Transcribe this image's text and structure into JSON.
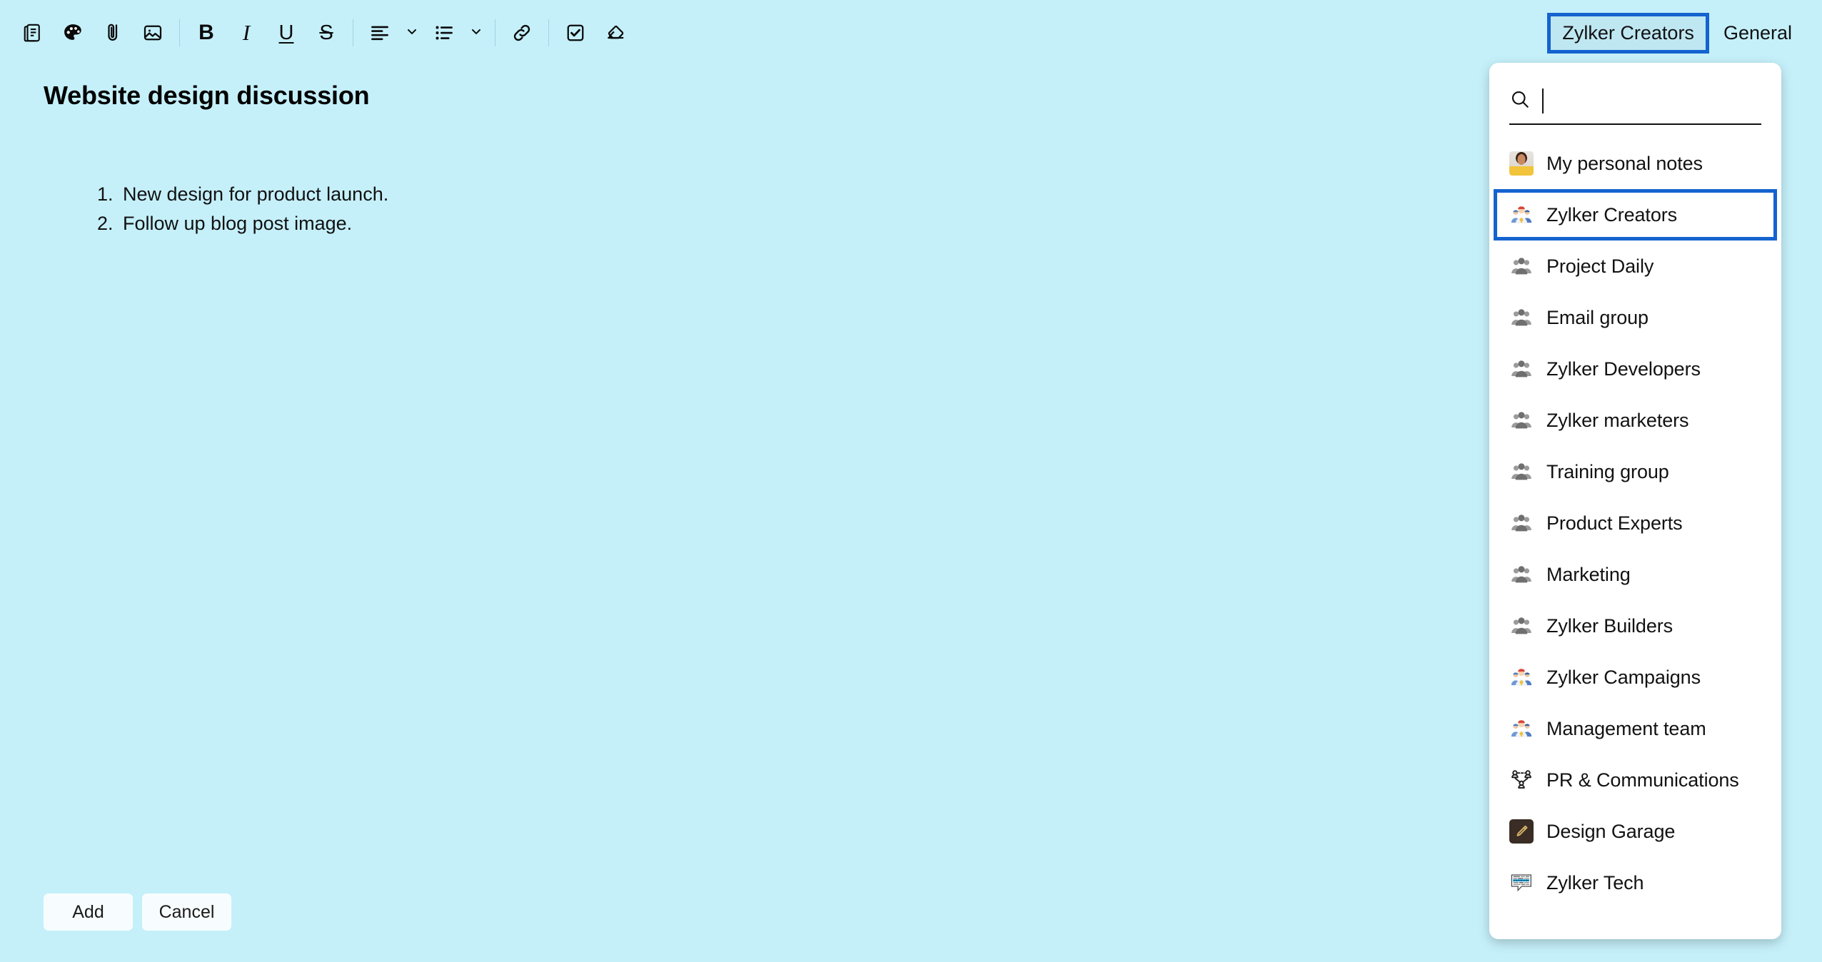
{
  "app": {
    "background_color": "#c5f0fa",
    "accent_focus_color": "#1463cf"
  },
  "toolbar": {
    "items": [
      {
        "icon": "note-icon",
        "label": "Note"
      },
      {
        "icon": "palette-icon",
        "label": "Color"
      },
      {
        "icon": "paperclip-icon",
        "label": "Attach"
      },
      {
        "icon": "image-icon",
        "label": "Image"
      },
      {
        "icon": "bold-icon",
        "label": "B"
      },
      {
        "icon": "italic-icon",
        "label": "I"
      },
      {
        "icon": "underline-icon",
        "label": "U"
      },
      {
        "icon": "strikethrough-icon",
        "label": "S"
      },
      {
        "icon": "align-left-icon",
        "label": "Align"
      },
      {
        "icon": "bullet-list-icon",
        "label": "List"
      },
      {
        "icon": "link-icon",
        "label": "Link"
      },
      {
        "icon": "checkbox-icon",
        "label": "Checklist"
      },
      {
        "icon": "eraser-icon",
        "label": "Clear formatting"
      }
    ]
  },
  "top_tabs": {
    "selected": "Zylker Creators",
    "items": [
      {
        "label": "Zylker Creators",
        "focused": true
      },
      {
        "label": "General",
        "focused": false
      }
    ]
  },
  "document": {
    "title": "Website design discussion",
    "list_items": [
      "New design for product launch.",
      "Follow up blog post image."
    ]
  },
  "footer": {
    "add_label": "Add",
    "cancel_label": "Cancel"
  },
  "dropdown": {
    "search": {
      "value": "",
      "placeholder": "",
      "icon": "search-icon"
    },
    "items": [
      {
        "label": "My personal notes",
        "icon": "avatar-photo",
        "focused": false
      },
      {
        "label": "Zylker Creators",
        "icon": "group-color-icon",
        "focused": true
      },
      {
        "label": "Project Daily",
        "icon": "group-gray-icon",
        "focused": false
      },
      {
        "label": "Email group",
        "icon": "group-gray-icon",
        "focused": false
      },
      {
        "label": "Zylker Developers",
        "icon": "group-gray-icon",
        "focused": false
      },
      {
        "label": "Zylker marketers",
        "icon": "group-gray-icon",
        "focused": false
      },
      {
        "label": "Training group",
        "icon": "group-gray-icon",
        "focused": false
      },
      {
        "label": "Product Experts",
        "icon": "group-gray-icon",
        "focused": false
      },
      {
        "label": "Marketing",
        "icon": "group-gray-icon",
        "focused": false
      },
      {
        "label": "Zylker Builders",
        "icon": "group-gray-icon",
        "focused": false
      },
      {
        "label": "Zylker Campaigns",
        "icon": "group-color-icon",
        "focused": false
      },
      {
        "label": "Management team",
        "icon": "group-color-icon",
        "focused": false
      },
      {
        "label": "PR & Communications",
        "icon": "network-people-icon",
        "focused": false
      },
      {
        "label": "Design Garage",
        "icon": "pencil-tile-icon",
        "focused": false
      },
      {
        "label": "Zylker Tech",
        "icon": "word-cloud-icon",
        "focused": false
      }
    ]
  }
}
